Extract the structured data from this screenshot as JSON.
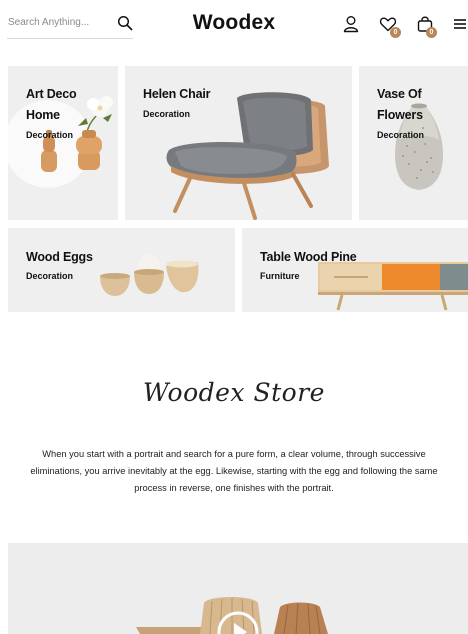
{
  "header": {
    "search_placeholder": "Search Anything...",
    "brand": "Woodex",
    "wishlist_count": "0",
    "cart_count": "0"
  },
  "cards": [
    {
      "title_line1": "Art Deco",
      "title_line2": "Home",
      "category": "Decoration"
    },
    {
      "title_line1": "Helen Chair",
      "category": "Decoration"
    },
    {
      "title_line1": "Vase Of",
      "title_line2": "Flowers",
      "category": "Decoration"
    },
    {
      "title_line1": "Wood Eggs",
      "category": "Decoration"
    },
    {
      "title_line1": "Table Wood Pine",
      "category": "Furniture"
    }
  ],
  "about": {
    "heading": "Woodex Store",
    "body": "When you start with a portrait and search for a pure form, a clear volume, through successive eliminations, you arrive inevitably at the egg. Likewise, starting with the egg and following the same process in reverse, one finishes with the portrait."
  },
  "colors": {
    "accent": "#b9855a",
    "card_bg": "#efefef"
  },
  "icons": [
    "search-icon",
    "user-icon",
    "heart-icon",
    "bag-icon",
    "menu-icon",
    "play-icon"
  ]
}
